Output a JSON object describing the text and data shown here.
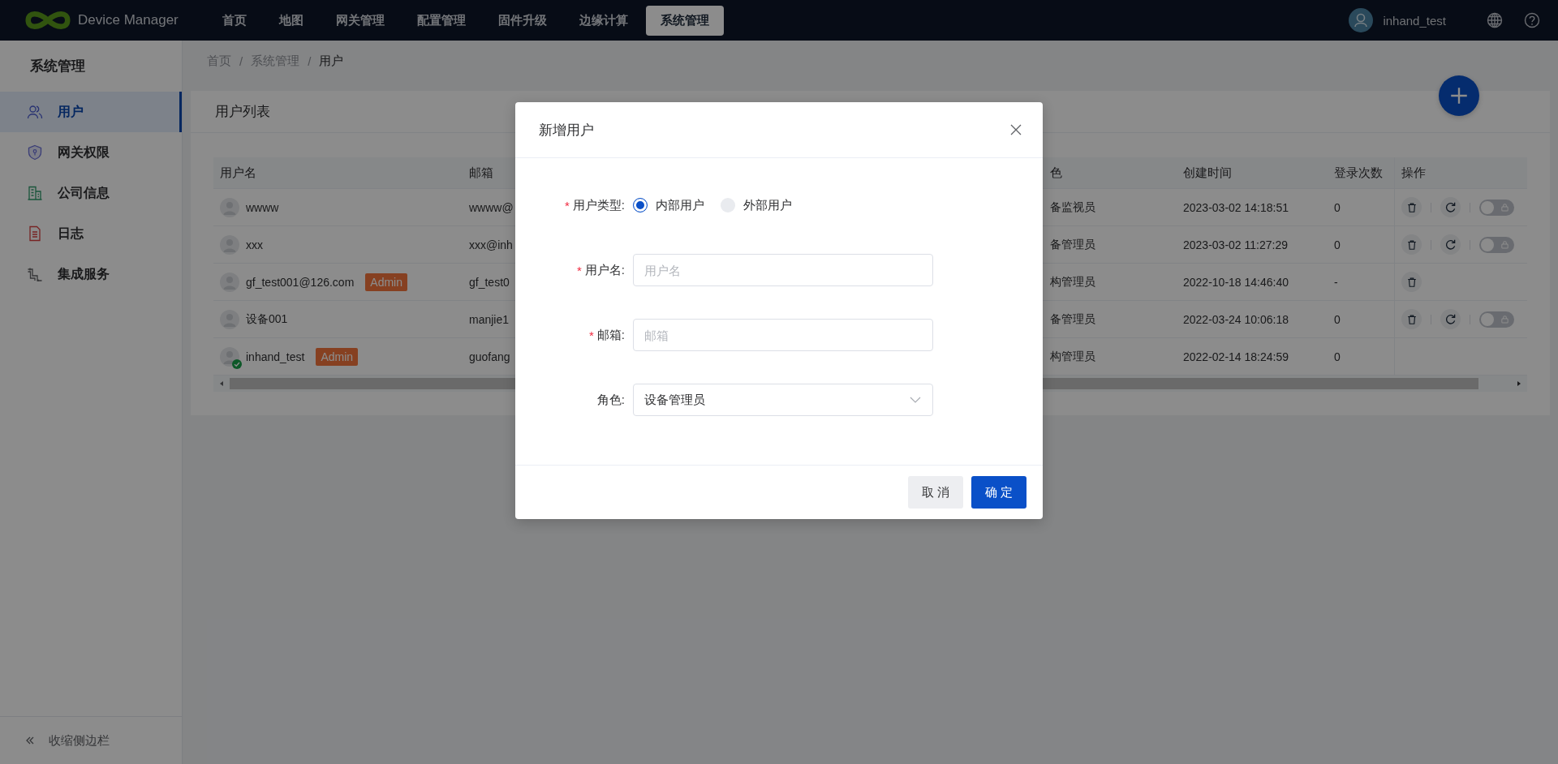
{
  "brand": "Device Manager",
  "nav": [
    {
      "label": "首页",
      "selected": false
    },
    {
      "label": "地图",
      "selected": false
    },
    {
      "label": "网关管理",
      "selected": false
    },
    {
      "label": "配置管理",
      "selected": false
    },
    {
      "label": "固件升级",
      "selected": false
    },
    {
      "label": "边缘计算",
      "selected": false
    },
    {
      "label": "系统管理",
      "selected": true
    }
  ],
  "user": {
    "name": "inhand_test"
  },
  "sidebar": {
    "title": "系统管理",
    "items": [
      {
        "kind": "users",
        "label": "用户",
        "selected": true
      },
      {
        "kind": "shield",
        "label": "网关权限",
        "selected": false
      },
      {
        "kind": "company",
        "label": "公司信息",
        "selected": false
      },
      {
        "kind": "log",
        "label": "日志",
        "selected": false
      },
      {
        "kind": "integration",
        "label": "集成服务",
        "selected": false
      }
    ],
    "collapse": "收缩侧边栏"
  },
  "breadcrumb": [
    {
      "kind": "link",
      "text": "首页"
    },
    {
      "kind": "separator",
      "text": "/"
    },
    {
      "kind": "link",
      "text": "系统管理"
    },
    {
      "kind": "separator",
      "text": "/"
    },
    {
      "kind": "current",
      "text": "用户"
    }
  ],
  "card": {
    "title": "用户列表"
  },
  "table": {
    "columns": [
      "用户名",
      "邮箱",
      "色",
      "创建时间",
      "登录次数",
      "操作"
    ],
    "rows": [
      {
        "name": "wwww",
        "verified": false,
        "email": "wwww@",
        "role": "备监视员",
        "created": "2023-03-02 14:18:51",
        "logins": "0",
        "actions": [
          {
            "kind": "delete"
          },
          {
            "kind": "reset"
          },
          {
            "kind": "lock",
            "on": false
          }
        ]
      },
      {
        "name": "xxx",
        "verified": false,
        "email": "xxx@inh",
        "role": "备管理员",
        "created": "2023-03-02 11:27:29",
        "logins": "0",
        "actions": [
          {
            "kind": "delete"
          },
          {
            "kind": "reset"
          },
          {
            "kind": "lock",
            "on": false
          }
        ]
      },
      {
        "name": "gf_test001@126.com",
        "badge": "Admin",
        "verified": false,
        "email": "gf_test0",
        "role": "构管理员",
        "created": "2022-10-18 14:46:40",
        "logins": "-",
        "actions": [
          {
            "kind": "delete"
          }
        ]
      },
      {
        "name": "设备001",
        "verified": false,
        "email": "manjie1",
        "role": "备管理员",
        "created": "2022-03-24 10:06:18",
        "logins": "0",
        "actions": [
          {
            "kind": "delete"
          },
          {
            "kind": "reset"
          },
          {
            "kind": "lock",
            "on": false
          }
        ]
      },
      {
        "name": "inhand_test",
        "badge": "Admin",
        "verified": true,
        "email": "guofang",
        "role": "构管理员",
        "created": "2022-02-14 18:24:59",
        "logins": "0",
        "actions": []
      }
    ]
  },
  "dialog": {
    "title": "新增用户",
    "fields": [
      {
        "kind": "radio",
        "required_mark": "*",
        "label": "用户类型:",
        "options": [
          {
            "label": "内部用户",
            "selected": true
          },
          {
            "label": "外部用户",
            "selected": false
          }
        ]
      },
      {
        "kind": "text",
        "required_mark": "*",
        "label": "用户名:",
        "placeholder": "用户名"
      },
      {
        "kind": "text",
        "required_mark": "*",
        "label": "邮箱:",
        "placeholder": "邮箱"
      },
      {
        "kind": "select",
        "label": "角色:",
        "value": "设备管理员"
      }
    ],
    "buttons": [
      {
        "kind": "cancel",
        "label": "取 消"
      },
      {
        "kind": "primary",
        "label": "确 定"
      }
    ]
  }
}
